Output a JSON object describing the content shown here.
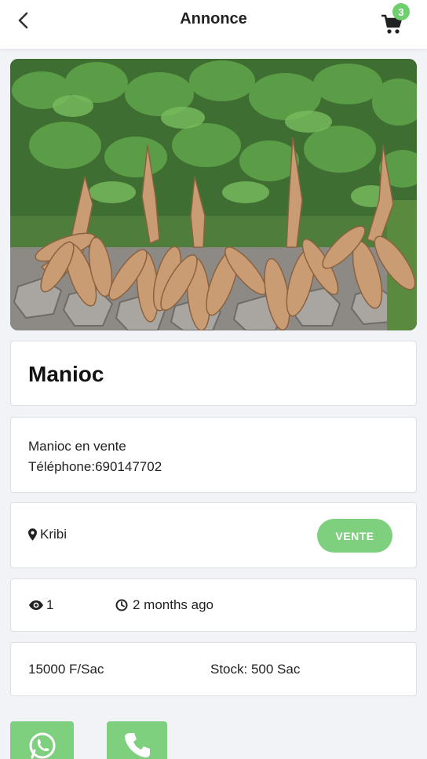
{
  "header": {
    "title": "Annonce",
    "cart_count": "3"
  },
  "product": {
    "name": "Manioc",
    "description_line1": "Manioc en vente",
    "description_line2": "Téléphone:690147702",
    "location": "Kribi",
    "type_label": "VENTE",
    "views": "1",
    "posted": "2 months ago",
    "price": "15000 F/Sac",
    "stock": "Stock: 500 Sac"
  },
  "colors": {
    "accent": "#7ed07e",
    "badge": "#6fcf6f",
    "background": "#f1f3f7"
  },
  "icons": [
    "back-icon",
    "cart-icon",
    "map-marker-icon",
    "eye-icon",
    "clock-icon",
    "whatsapp-icon",
    "phone-icon"
  ]
}
